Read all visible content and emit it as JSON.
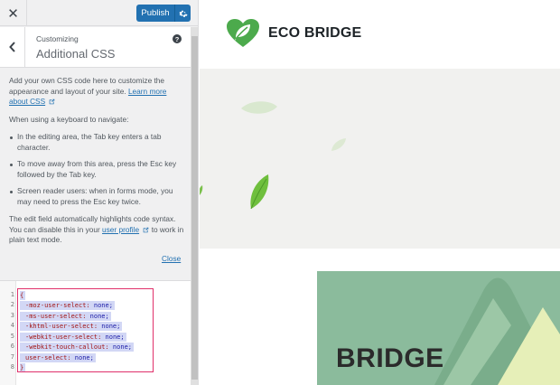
{
  "topbar": {
    "close_icon": "close-icon",
    "publish_label": "Publish",
    "publish_color": "#2271b1"
  },
  "section": {
    "breadcrumb": "Customizing",
    "title": "Additional CSS",
    "help_icon": "?"
  },
  "description": {
    "intro_text": "Add your own CSS code here to customize the appearance and layout of your site.",
    "learn_more_link": "Learn more about CSS",
    "keyboard_heading": "When using a keyboard to navigate:",
    "bullets": [
      "In the editing area, the Tab key enters a tab character.",
      "To move away from this area, press the Esc key followed by the Tab key.",
      "Screen reader users: when in forms mode, you may need to press the Esc key twice."
    ],
    "syntax_text_before": "The edit field automatically highlights code syntax. You can disable this in your",
    "user_profile_link": "user profile",
    "syntax_text_after": "to work in plain text mode.",
    "close_link": "Close"
  },
  "editor": {
    "line_numbers": [
      "1",
      "2",
      "3",
      "4",
      "5",
      "6",
      "7",
      "8"
    ],
    "lines": [
      {
        "prop": "{",
        "val": ""
      },
      {
        "prop": "-moz-user-select:",
        "val": " none;"
      },
      {
        "prop": "-ms-user-select:",
        "val": " none;"
      },
      {
        "prop": "-khtml-user-select:",
        "val": " none;"
      },
      {
        "prop": "-webkit-user-select:",
        "val": " none;"
      },
      {
        "prop": "-webkit-touch-callout:",
        "val": " none;"
      },
      {
        "prop": "user-select:",
        "val": " none;"
      },
      {
        "prop": "}",
        "val": ""
      }
    ],
    "highlight_color": "#e0306a"
  },
  "preview": {
    "logo_text": "ECO BRIDGE",
    "brand_color": "#4caa4c",
    "promo_text": "BRIDGE"
  }
}
